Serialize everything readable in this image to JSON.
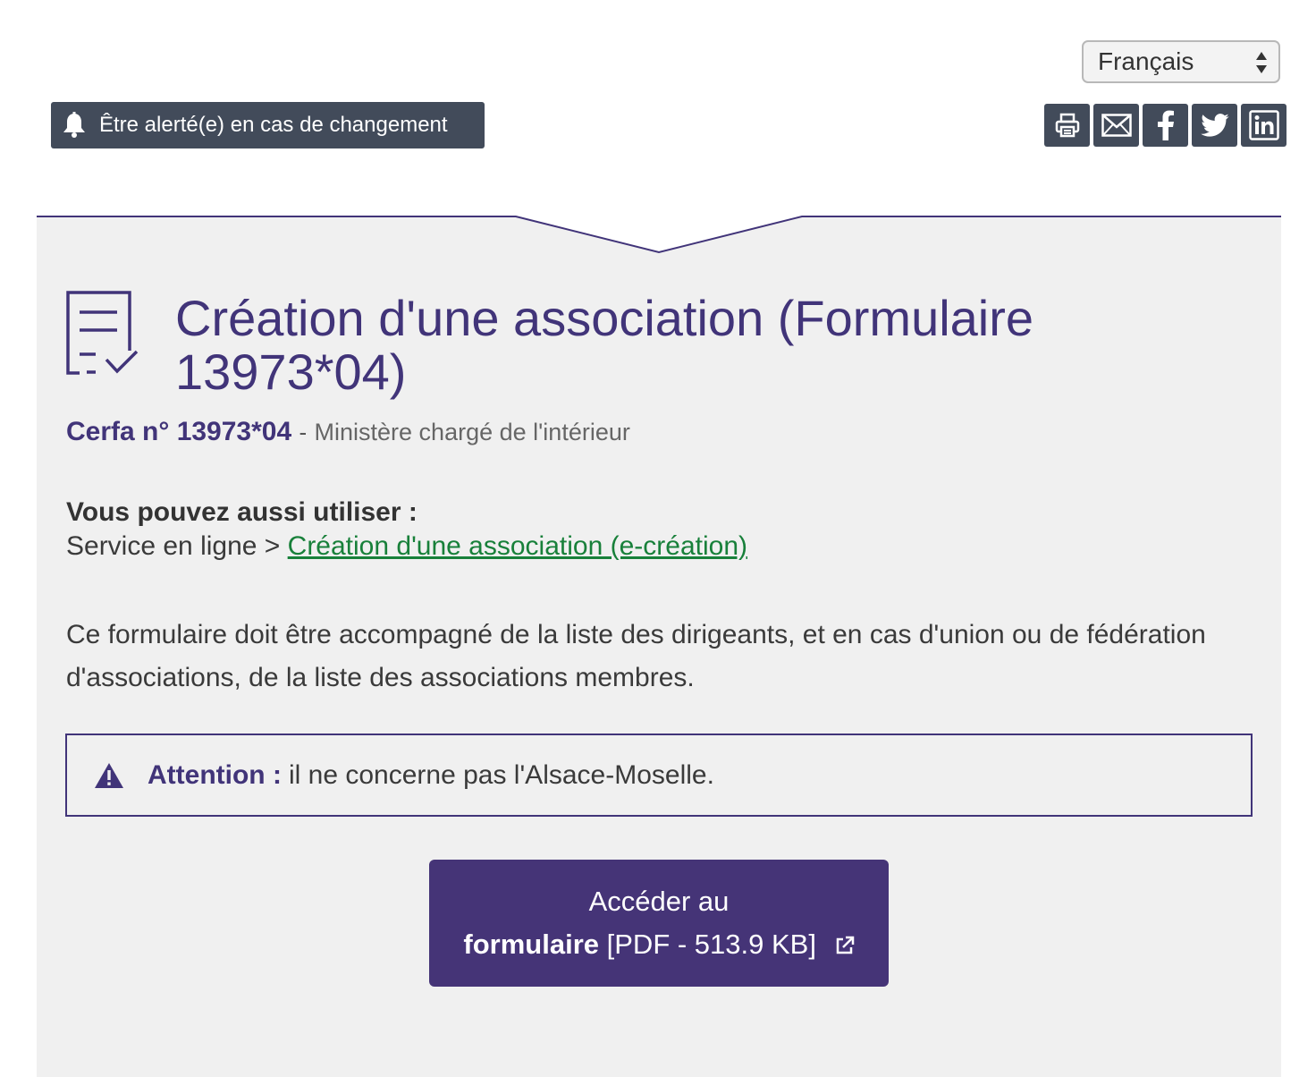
{
  "language_select": {
    "value": "Français"
  },
  "alert_button": {
    "label": "Être alerté(e) en cas de changement"
  },
  "share": {
    "icons": [
      "print-icon",
      "email-icon",
      "facebook-icon",
      "twitter-icon",
      "linkedin-icon"
    ]
  },
  "form": {
    "title": "Création d'une association (Formulaire 13973*04)",
    "cerfa_number": "Cerfa n° 13973*04",
    "separator": "-",
    "ministry": "Ministère chargé de l'intérieur",
    "also_use_title": "Vous pouvez aussi utiliser :",
    "also_use_prefix": "Service en ligne >",
    "also_use_link": "Création d'une association (e-création)",
    "description": "Ce formulaire doit être accompagné de la liste des dirigeants, et en cas d'union ou de fédération d'associations, de la liste des associations membres.",
    "warning_label": "Attention :",
    "warning_text": "il ne concerne pas l'Alsace-Moselle.",
    "cta_line1": "Accéder au",
    "cta_bold": "formulaire",
    "cta_meta": "[PDF - 513.9 KB]"
  },
  "colors": {
    "brand_purple": "#413479",
    "button_dark": "#424b5a",
    "link_green": "#18803a",
    "card_bg": "#f0f0f0"
  }
}
